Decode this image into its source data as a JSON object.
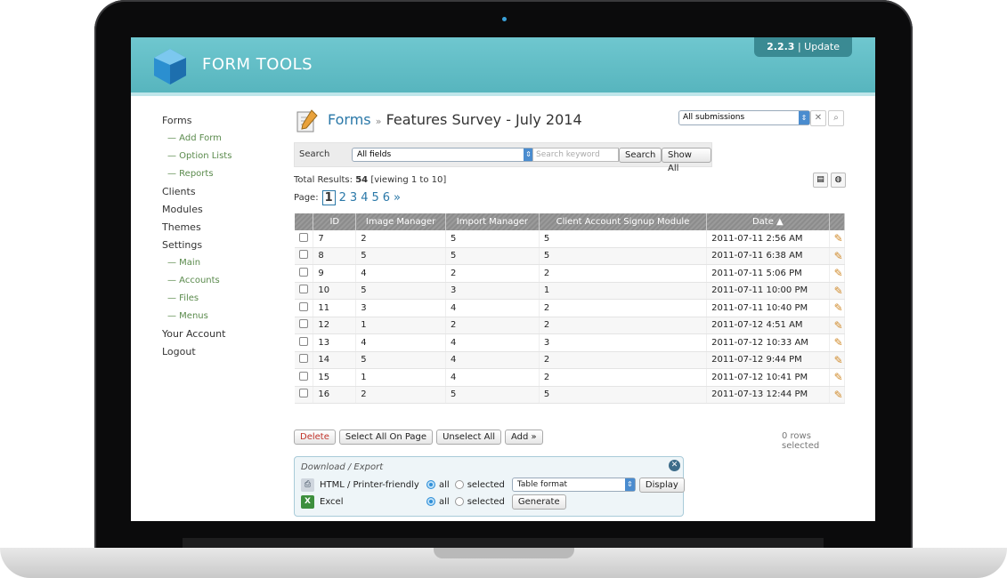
{
  "header": {
    "app_name": "FORM TOOLS",
    "version": "2.2.3",
    "update_label": "Update"
  },
  "nav": {
    "items": [
      {
        "label": "Forms",
        "sub": false
      },
      {
        "label": "— Add Form",
        "sub": true
      },
      {
        "label": "— Option Lists",
        "sub": true
      },
      {
        "label": "— Reports",
        "sub": true
      },
      {
        "label": "Clients",
        "sub": false
      },
      {
        "label": "Modules",
        "sub": false
      },
      {
        "label": "Themes",
        "sub": false
      },
      {
        "label": "Settings",
        "sub": false
      },
      {
        "label": "— Main",
        "sub": true
      },
      {
        "label": "— Accounts",
        "sub": true
      },
      {
        "label": "— Files",
        "sub": true
      },
      {
        "label": "— Menus",
        "sub": true
      },
      {
        "label": "Your Account",
        "sub": false
      },
      {
        "label": "Logout",
        "sub": false
      }
    ]
  },
  "page": {
    "crumb": "Forms",
    "separator": "»",
    "title": "Features Survey - July 2014",
    "view_selected": "All submissions"
  },
  "search": {
    "label": "Search",
    "field_selected": "All fields",
    "keyword_placeholder": "Search keyword",
    "search_button": "Search",
    "show_all_button": "Show All"
  },
  "results": {
    "total_label": "Total Results:",
    "total": "54",
    "viewing": "[viewing 1 to 10]",
    "page_label": "Page:",
    "pages": [
      "1",
      "2",
      "3",
      "4",
      "5",
      "6"
    ],
    "current_page": "1",
    "next": "»"
  },
  "table": {
    "columns": [
      "ID",
      "Image Manager",
      "Import Manager",
      "Client Account Signup Module",
      "Date ▲"
    ],
    "rows": [
      [
        "7",
        "2",
        "5",
        "5",
        "2011-07-11 2:56 AM"
      ],
      [
        "8",
        "5",
        "5",
        "5",
        "2011-07-11 6:38 AM"
      ],
      [
        "9",
        "4",
        "2",
        "2",
        "2011-07-11 5:06 PM"
      ],
      [
        "10",
        "5",
        "3",
        "1",
        "2011-07-11 10:00 PM"
      ],
      [
        "11",
        "3",
        "4",
        "2",
        "2011-07-11 10:40 PM"
      ],
      [
        "12",
        "1",
        "2",
        "2",
        "2011-07-12 4:51 AM"
      ],
      [
        "13",
        "4",
        "4",
        "3",
        "2011-07-12 10:33 AM"
      ],
      [
        "14",
        "5",
        "4",
        "2",
        "2011-07-12 9:44 PM"
      ],
      [
        "15",
        "1",
        "4",
        "2",
        "2011-07-12 10:41 PM"
      ],
      [
        "16",
        "2",
        "5",
        "5",
        "2011-07-13 12:44 PM"
      ]
    ]
  },
  "actions": {
    "delete": "Delete",
    "select_all": "Select All On Page",
    "unselect_all": "Unselect All",
    "add": "Add »",
    "rows_selected": "0 rows selected"
  },
  "export": {
    "heading": "Download / Export",
    "html_label": "HTML / Printer-friendly",
    "excel_label": "Excel",
    "all_label": "all",
    "selected_label": "selected",
    "format_selected": "Table format",
    "display_button": "Display",
    "generate_button": "Generate"
  }
}
